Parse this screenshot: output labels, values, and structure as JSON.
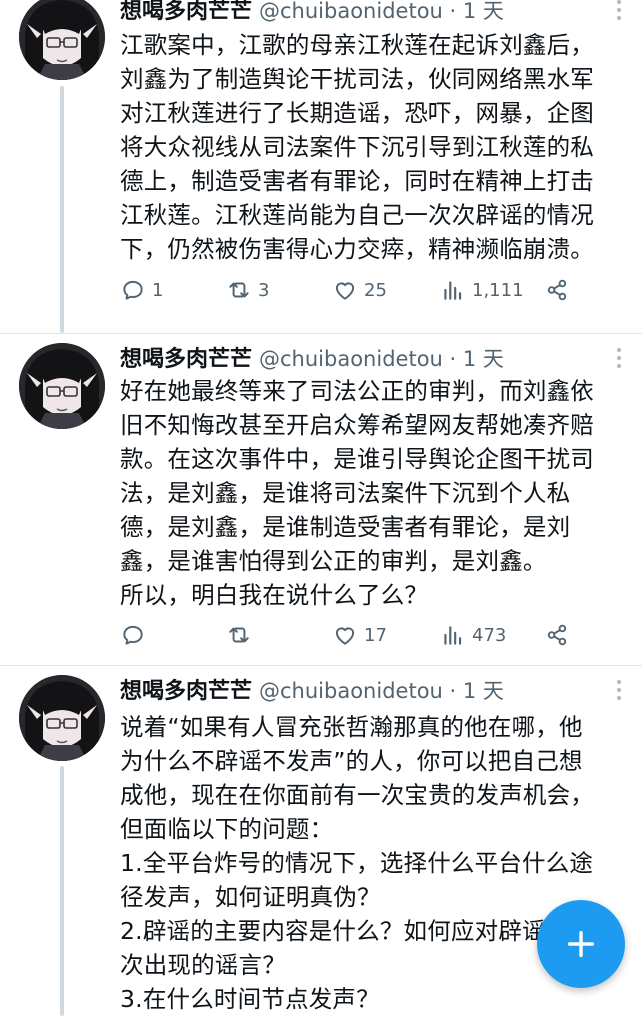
{
  "colors": {
    "accent": "#1d9bf0",
    "text": "#0f1419",
    "secondary": "#536471"
  },
  "tweets": [
    {
      "author": "想喝多肉芒芒",
      "handle": "@chuibaonidetou · 1 天",
      "lines": [
        "江歌案中，江歌的母亲江秋莲在起诉刘鑫后，",
        "刘鑫为了制造舆论干扰司法，伙同网络黑水军",
        "对江秋莲进行了长期造谣，恐吓，网暴，企图",
        "将大众视线从司法案件下沉引导到江秋莲的私",
        "德上，制造受害者有罪论，同时在精神上打击",
        "江秋莲。江秋莲尚能为自己一次次辟谣的情况",
        "下，仍然被伤害得心力交瘁，精神濒临崩溃。"
      ],
      "replies": "1",
      "retweets": "3",
      "likes": "25",
      "views": "1,111"
    },
    {
      "author": "想喝多肉芒芒",
      "handle": "@chuibaonidetou · 1 天",
      "lines": [
        "好在她最终等来了司法公正的审判，而刘鑫依",
        "旧不知悔改甚至开启众筹希望网友帮她凑齐赔",
        "款。在这次事件中，是谁引导舆论企图干扰司",
        "法，是刘鑫，是谁将司法案件下沉到个人私",
        "德，是刘鑫，是谁制造受害者有罪论，是刘",
        "鑫，是谁害怕得到公正的审判，是刘鑫。",
        "所以，明白我在说什么了么？"
      ],
      "replies": "",
      "retweets": "",
      "likes": "17",
      "views": "473"
    },
    {
      "author": "想喝多肉芒芒",
      "handle": "@chuibaonidetou · 1 天",
      "lines": [
        "说着“如果有人冒充张哲瀚那真的他在哪，他",
        "为什么不辟谣不发声”的人，你可以把自己想",
        "成他，现在在你面前有一次宝贵的发声机会，",
        "但面临以下的问题：",
        "1.全平台炸号的情况下，选择什么平台什么途",
        "径发声，如何证明真伪？",
        "2.辟谣的主要内容是什么？如何应对辟谣后再",
        "次出现的谣言？",
        "3.在什么时间节点发声？"
      ]
    }
  ]
}
